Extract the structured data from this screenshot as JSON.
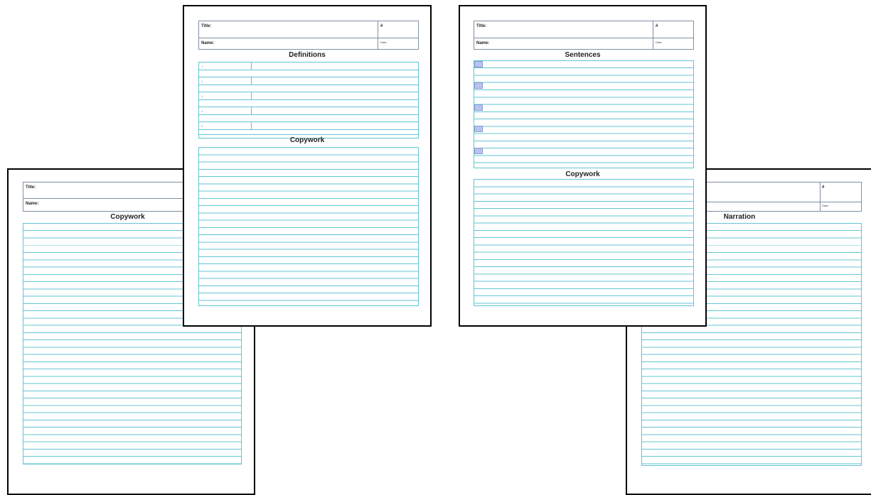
{
  "pages": {
    "copywork": {
      "title_label": "Title:",
      "name_label": "Name:",
      "section": "Copywork"
    },
    "definitions": {
      "title_label": "Title:",
      "name_label": "Name:",
      "number_label": "#",
      "date_label": "Date:",
      "section_definitions": "Definitions",
      "definition_numbers": [
        "1.",
        "2.",
        "3.",
        "4.",
        "5."
      ],
      "section_copywork": "Copywork"
    },
    "sentences": {
      "title_label": "Title:",
      "name_label": "Name:",
      "number_label": "#",
      "date_label": "Date:",
      "section_sentences": "Sentences",
      "section_copywork": "Copywork"
    },
    "narration": {
      "number_label": "#",
      "date_label": "Date:",
      "section": "Narration"
    }
  },
  "colors": {
    "ruling": "#62c5d3",
    "header_border": "#7f8fa6",
    "sentence_marker": "#b9c4ee"
  }
}
